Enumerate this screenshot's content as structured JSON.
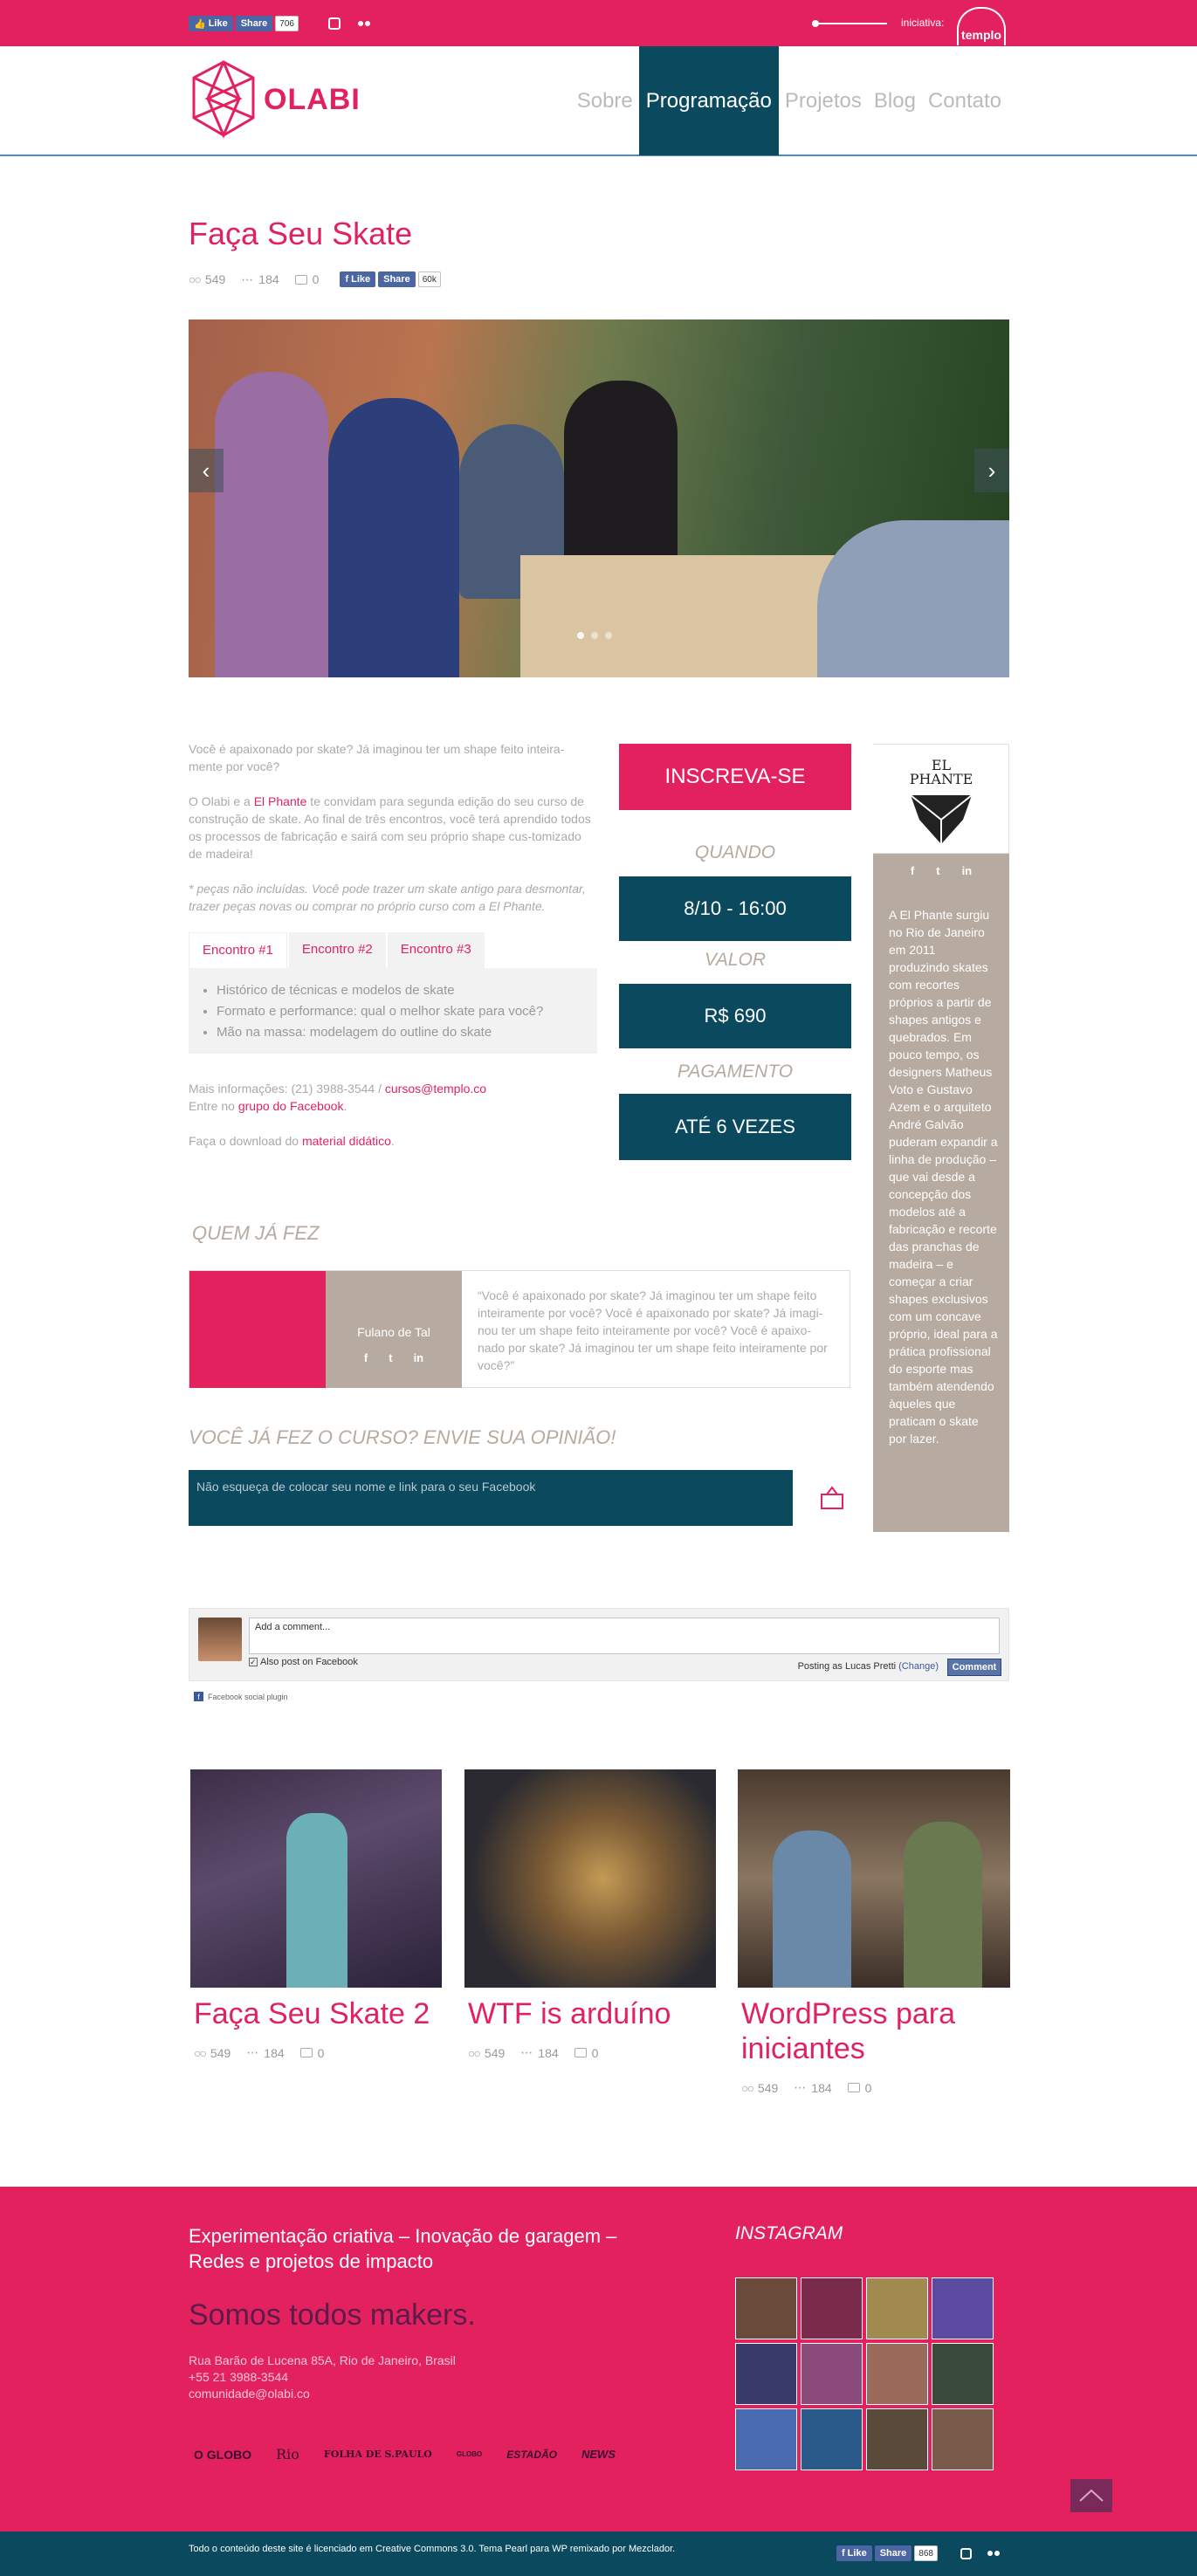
{
  "topbar": {
    "like_label": "Like",
    "share_label": "Share",
    "share_count": "706",
    "iniciativa_label": "iniciativa:",
    "templo_label": "templo"
  },
  "header": {
    "logo_text": "OLABI",
    "nav": [
      {
        "label": "Sobre",
        "active": false
      },
      {
        "label": "Programação",
        "active": true
      },
      {
        "label": "Projetos",
        "active": false
      },
      {
        "label": "Blog",
        "active": false
      },
      {
        "label": "Contato",
        "active": false
      }
    ]
  },
  "post": {
    "title": "Faça Seu Skate",
    "views": "549",
    "shares": "184",
    "comments": "0",
    "like_label": "Like",
    "share_label": "Share",
    "share_count": "60k"
  },
  "content": {
    "intro": "Você é apaixonado por skate? Já imaginou ter um shape feito inteira-mente por você?",
    "para2_a": "O Olabi e a ",
    "para2_link": "El Phante",
    "para2_b": " te convidam para segunda edição do seu curso de construção de skate. Ao final de três encontros, você terá aprendido todos os processos de fabricação e sairá com seu próprio shape cus-tomizado de madeira!",
    "note": "* peças não incluídas. Você pode trazer um skate antigo para desmontar, trazer peças novas ou comprar no próprio curso com a El Phante.",
    "tabs": [
      "Encontro #1",
      "Encontro #2",
      "Encontro #3"
    ],
    "tab_items": [
      "Histórico de técnicas e modelos de skate",
      "Formato e performance: qual o melhor skate para você?",
      "Mão na massa: modelagem do outline do skate"
    ],
    "info_a": "Mais informações: (21) 3988-3544 / ",
    "info_email": "cursos@templo.co",
    "info_b": "Entre no ",
    "info_group": "grupo do Facebook",
    "info_c": ".",
    "download_a": "Faça o download do ",
    "download_link": "material didático",
    "download_b": "."
  },
  "signup": {
    "button": "INSCREVA-SE",
    "quando_label": "QUANDO",
    "quando_value": "8/10 - 16:00",
    "valor_label": "VALOR",
    "valor_value": "R$ 690",
    "pagamento_label": "PAGAMENTO",
    "pagamento_value": "ATÉ 6 VEZES"
  },
  "partner": {
    "name": "EL PHANTE",
    "social": [
      "f",
      "t",
      "in"
    ],
    "description": "A El Phante surgiu no Rio de Janeiro em 2011 produzindo skates com recortes próprios a partir de shapes antigos e quebrados. Em pouco tempo, os designers Matheus Voto e Gustavo Azem e o arquiteto André Galvão puderam expandir a linha de produção – que vai desde a concepção dos modelos até a fabricação e recorte das pranchas de madeira – e começar a criar shapes exclusivos com um concave próprio, ideal para a prática profissional do esporte mas também atendendo àqueles que praticam o skate por lazer."
  },
  "testimonial": {
    "section_label": "QUEM JÁ FEZ",
    "name": "Fulano de Tal",
    "social": [
      "f",
      "t",
      "in"
    ],
    "quote": "“Você é apaixonado por skate? Já imaginou ter um shape feito inteiramente por você? Você é apaixonado por skate? Já imagi-nou ter um shape feito inteiramente por você? Você é apaixo-nado por skate? Já imaginou ter um shape feito inteiramente por você?”"
  },
  "opinion": {
    "label": "VOCÊ JÁ FEZ O CURSO? ENVIE SUA OPINIÃO!",
    "placeholder": "Não esqueça de colocar seu nome e link para o seu Facebook"
  },
  "fb_comments": {
    "placeholder": "Add a comment...",
    "also_post": "Also post on Facebook",
    "posting_as": "Posting as Lucas Pretti",
    "change": "(Change)",
    "comment_button": "Comment",
    "plugin_label": "Facebook social plugin"
  },
  "related": [
    {
      "title": "Faça Seu Skate 2",
      "views": "549",
      "shares": "184",
      "comments": "0"
    },
    {
      "title": "WTF is arduíno",
      "views": "549",
      "shares": "184",
      "comments": "0"
    },
    {
      "title": "WordPress para iniciantes",
      "views": "549",
      "shares": "184",
      "comments": "0"
    }
  ],
  "footer": {
    "tagline": "Experimentação criativa – Inovação de garagem – Redes e projetos de impacto",
    "makers": "Somos todos makers.",
    "address": "Rua Barão de Lucena 85A, Rio de Janeiro, Brasil",
    "phone": "+55 21 3988-3544",
    "email": "comunidade@olabi.co",
    "press": [
      "O GLOBO",
      "Rio",
      "FOLHA DE S.PAULO",
      "GLOBO",
      "ESTADÃO",
      "NEWS"
    ],
    "instagram_label": "INSTAGRAM",
    "license": "Todo o conteúdo deste site é licenciado em Creative Commons 3.0. Tema Pearl para WP remixado por Mezclador.",
    "like_label": "Like",
    "share_label": "Share",
    "share_count": "868"
  },
  "colors": {
    "brand_pink": "#e4215f",
    "dark_teal": "#0b4a5e",
    "taupe": "#b7aaa0",
    "facebook_blue": "#4c66a4"
  }
}
